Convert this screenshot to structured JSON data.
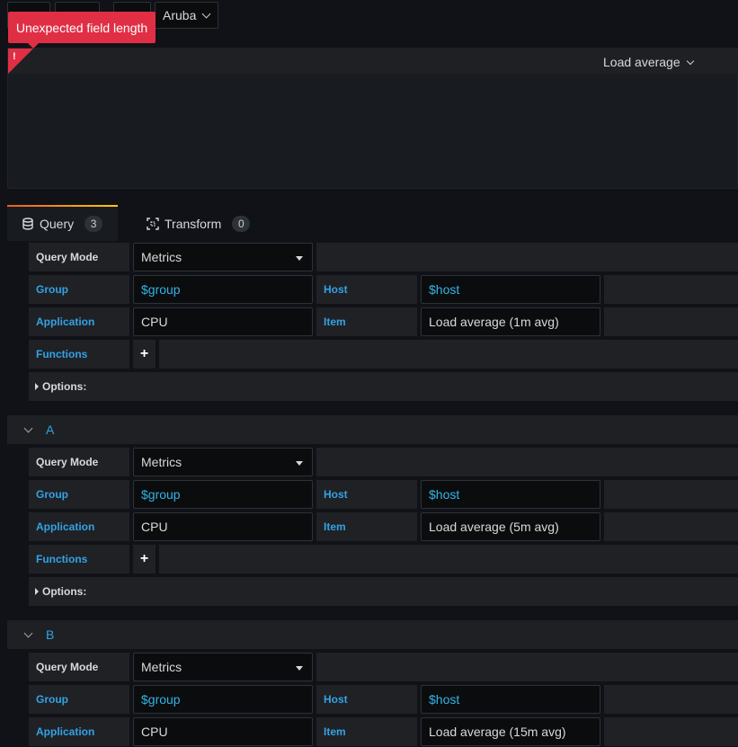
{
  "toolbar": {
    "datasource_label": "Aruba"
  },
  "panel": {
    "title": "Load average",
    "error": "Unexpected field length",
    "error_mark": "!"
  },
  "tabs": [
    {
      "label": "Query",
      "count": "3"
    },
    {
      "label": "Transform",
      "count": "0"
    }
  ],
  "queries": [
    {
      "ref": "",
      "query_mode_label": "Query Mode",
      "query_mode": "Metrics",
      "group_label": "Group",
      "group": "$group",
      "host_label": "Host",
      "host": "$host",
      "application_label": "Application",
      "application": "CPU",
      "item_label": "Item",
      "item": "Load average (1m avg)",
      "functions_label": "Functions",
      "add_symbol": "+",
      "options_label": "Options:"
    },
    {
      "ref": "A",
      "query_mode_label": "Query Mode",
      "query_mode": "Metrics",
      "group_label": "Group",
      "group": "$group",
      "host_label": "Host",
      "host": "$host",
      "application_label": "Application",
      "application": "CPU",
      "item_label": "Item",
      "item": "Load average (5m avg)",
      "functions_label": "Functions",
      "add_symbol": "+",
      "options_label": "Options:"
    },
    {
      "ref": "B",
      "query_mode_label": "Query Mode",
      "query_mode": "Metrics",
      "group_label": "Group",
      "group": "$group",
      "host_label": "Host",
      "host": "$host",
      "application_label": "Application",
      "application": "CPU",
      "item_label": "Item",
      "item": "Load average (15m avg)"
    }
  ]
}
